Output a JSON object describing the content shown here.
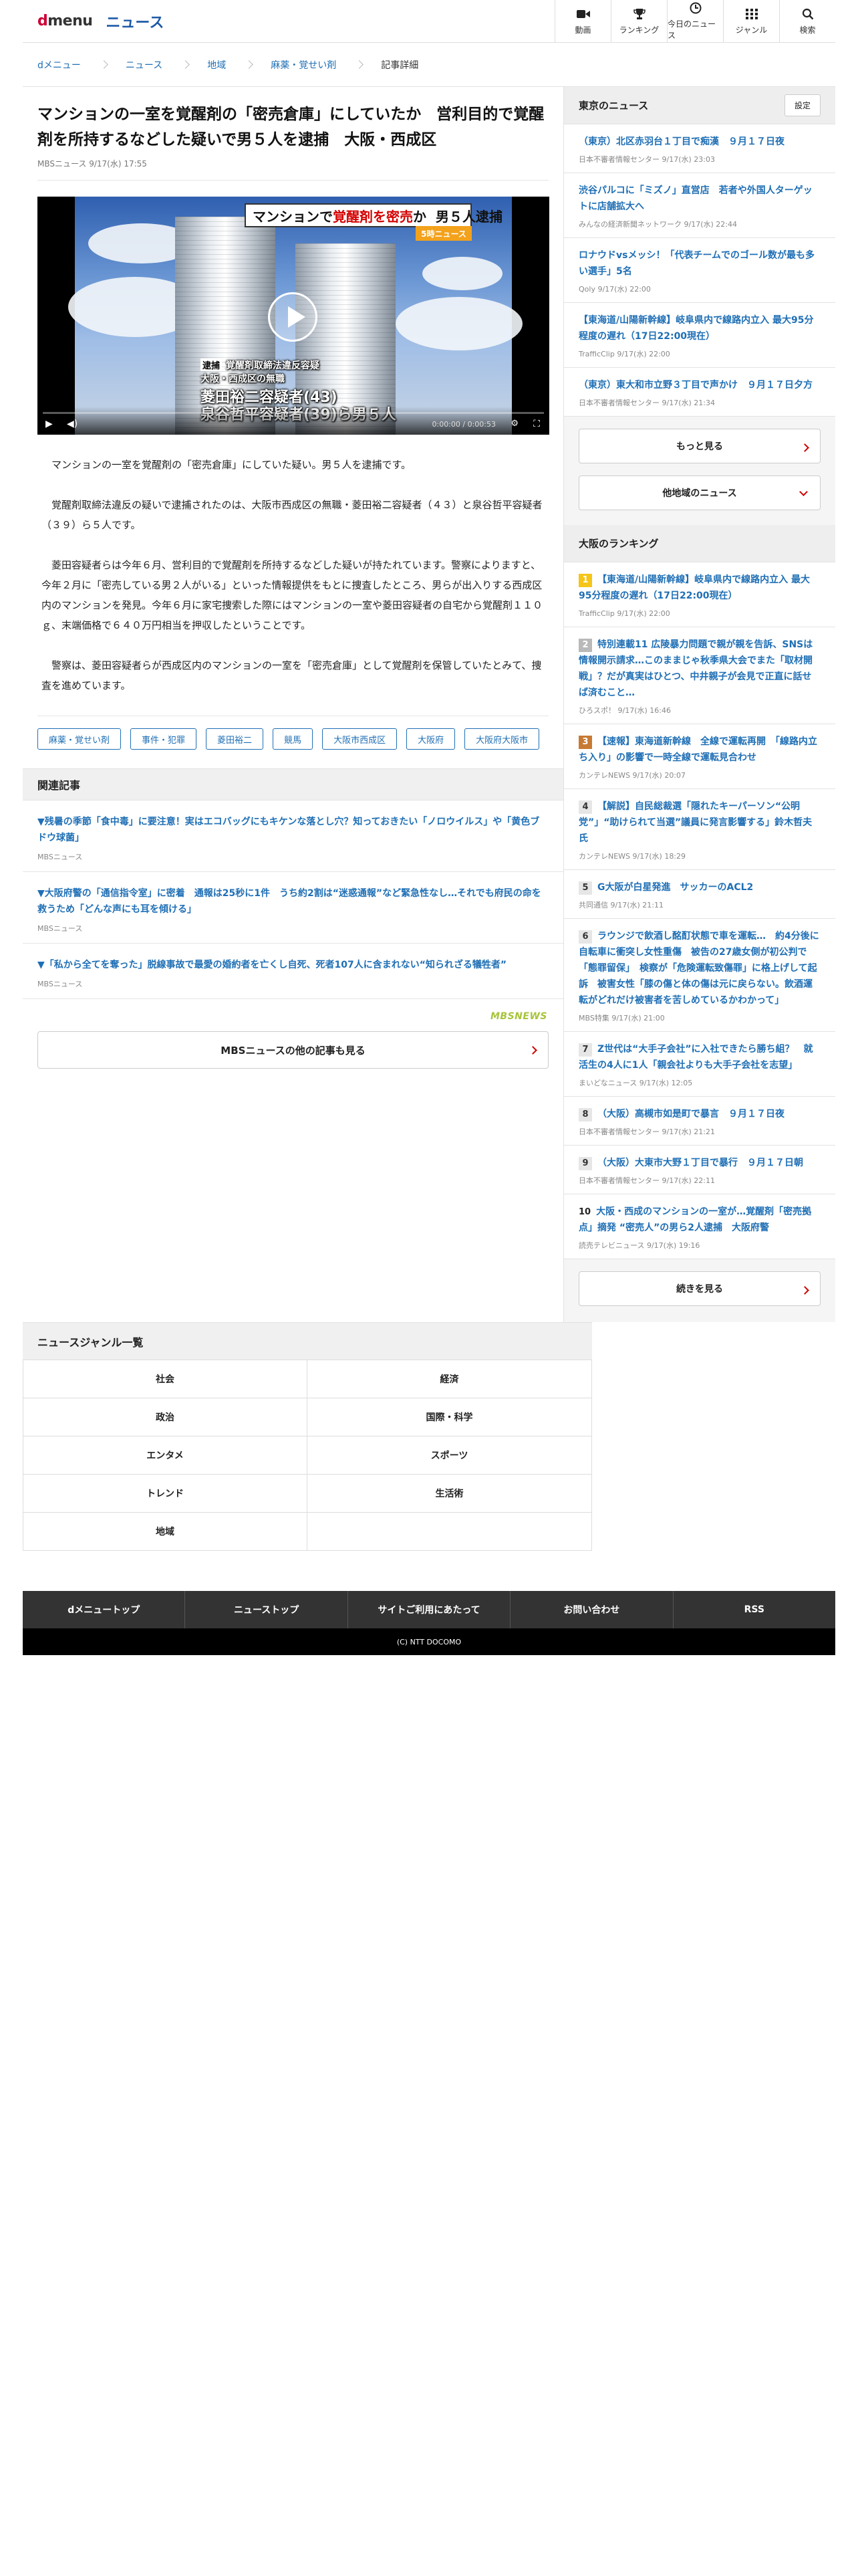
{
  "header": {
    "logo_d": "d",
    "logo_menu": "menu",
    "logo_news": "ニュース",
    "nav": [
      {
        "label": "動画",
        "icon": "video-camera-icon"
      },
      {
        "label": "ランキング",
        "icon": "trophy-icon"
      },
      {
        "label": "今日のニュース",
        "icon": "clock-icon"
      },
      {
        "label": "ジャンル",
        "icon": "grid-icon"
      },
      {
        "label": "検索",
        "icon": "search-icon"
      }
    ]
  },
  "breadcrumb": [
    "dメニュー",
    "ニュース",
    "地域",
    "麻薬・覚せい剤",
    "記事詳細"
  ],
  "article": {
    "title": "マンションの一室を覚醒剤の「密売倉庫」にしていたか　営利目的で覚醒剤を所持するなどした疑いで男５人を逮捕　大阪・西成区",
    "meta": "MBSニュース 9/17(水) 17:55",
    "video": {
      "banner_prefix": "マンションで",
      "banner_red": "覚醒剤を密売",
      "banner_suffix": "か",
      "banner_tail": "男５人逮捕",
      "badge": "5時ニュース",
      "cap_tag": "逮捕",
      "cap_line1": "覚醒剤取締法違反容疑",
      "cap_line2": "大阪・西成区の無職",
      "cap_line3": "菱田裕二容疑者(43)",
      "cap_line4": "泉谷哲平容疑者(39)ら男５人",
      "time": "0:00:00 / 0:00:53"
    },
    "paragraphs": [
      "マンションの一室を覚醒剤の「密売倉庫」にしていた疑い。男５人を逮捕です。",
      "覚醒剤取締法違反の疑いで逮捕されたのは、大阪市西成区の無職・菱田裕二容疑者（４３）と泉谷哲平容疑者（３９）ら５人です。",
      "菱田容疑者らは今年６月、営利目的で覚醒剤を所持するなどした疑いが持たれています。警察によりますと、今年２月に「密売している男２人がいる」といった情報提供をもとに捜査したところ、男らが出入りする西成区内のマンションを発見。今年６月に家宅捜索した際にはマンションの一室や菱田容疑者の自宅から覚醒剤１１０ｇ、末端価格で６４０万円相当を押収したということです。",
      "警察は、菱田容疑者らが西成区内のマンションの一室を「密売倉庫」として覚醒剤を保管していたとみて、捜査を進めています。"
    ],
    "tags": [
      "麻薬・覚せい剤",
      "事件・犯罪",
      "菱田裕二",
      "競馬",
      "大阪市西成区",
      "大阪府",
      "大阪府大阪市"
    ]
  },
  "related": {
    "heading": "関連記事",
    "items": [
      {
        "title": "▼残暑の季節「食中毒」に要注意！実はエコバッグにもキケンな落とし穴？知っておきたい「ノロウイルス」や「黄色ブドウ球菌」",
        "source": "MBSニュース"
      },
      {
        "title": "▼大阪府警の「通信指令室」に密着　通報は25秒に1件　うち約2割は“迷惑通報”など緊急性なし…それでも府民の命を救うため「どんな声にも耳を傾ける」",
        "source": "MBSニュース"
      },
      {
        "title": "▼「私から全てを奪った」脱線事故で最愛の婚約者を亡くし自死、死者107人に含まれない“知られざる犠牲者”",
        "source": "MBSニュース"
      }
    ],
    "provider_logo": "MBSNEWS",
    "more_label": "MBSニュースの他の記事も見る"
  },
  "sidebar": {
    "local_heading": "東京のニュース",
    "settings_label": "設定",
    "local_items": [
      {
        "title": "（東京）北区赤羽台１丁目で痴漢　９月１７日夜",
        "source": "日本不審者情報センター 9/17(水) 23:03"
      },
      {
        "title": "渋谷パルコに「ミズノ」直営店　若者や外国人ターゲットに店舗拡大へ",
        "source": "みんなの経済新聞ネットワーク 9/17(水) 22:44"
      },
      {
        "title": "ロナウドvsメッシ！「代表チームでのゴール数が最も多い選手」5名",
        "source": "Qoly 9/17(水) 22:00"
      },
      {
        "title": "【東海道/山陽新幹線】岐阜県内で線路内立入 最大95分程度の遅れ（17日22:00現在）",
        "source": "TrafficClip 9/17(水) 22:00"
      },
      {
        "title": "（東京）東大和市立野３丁目で声かけ　９月１７日夕方",
        "source": "日本不審者情報センター 9/17(水) 21:34"
      }
    ],
    "more_label": "もっと見る",
    "other_region_label": "他地域のニュース",
    "ranking_heading": "大阪のランキング",
    "ranking": [
      {
        "rank": "1",
        "style": "gold",
        "title": "【東海道/山陽新幹線】岐阜県内で線路内立入 最大95分程度の遅れ（17日22:00現在）",
        "source": "TrafficClip 9/17(水) 22:00"
      },
      {
        "rank": "2",
        "style": "silver",
        "title": "特別連載11 広陵暴力問題で親が親を告訴、SNSは情報開示請求…このままじゃ秋季県大会でまた「取材開戦」？だが真実はひとつ、中井親子が会見で正直に話せば済むこと…",
        "source": "ひろスポ！ 9/17(水) 16:46"
      },
      {
        "rank": "3",
        "style": "bronze",
        "title": "【速報】東海道新幹線　全線で運転再開　「線路内立ち入り」の影響で一時全線で運転見合わせ",
        "source": "カンテレNEWS 9/17(水) 20:07"
      },
      {
        "rank": "4",
        "style": "plain",
        "title": "【解説】自民総裁選「隠れたキーパーソン“公明党”」“助けられて当選”議員に発言影響する」鈴木哲夫氏",
        "source": "カンテレNEWS 9/17(水) 18:29"
      },
      {
        "rank": "5",
        "style": "plain",
        "title": "G大阪が白星発進　サッカーのACL2",
        "source": "共同通信 9/17(水) 21:11"
      },
      {
        "rank": "6",
        "style": "plain",
        "title": "ラウンジで飲酒し酩酊状態で車を運転…　約4分後に自転車に衝突し女性重傷　被告の27歳女側が初公判で「態罪留保」　検察が「危険運転致傷罪」に格上げして起訴　被害女性「膝の傷と体の傷は元に戻らない。飲酒運転がどれだけ被害者を苦しめているかわかって」",
        "source": "MBS特集 9/17(水) 21:00"
      },
      {
        "rank": "7",
        "style": "plain",
        "title": "Z世代は“大手子会社”に入社できたら勝ち組？　就活生の4人に1人「親会社よりも大手子会社を志望」",
        "source": "まいどなニュース 9/17(水) 12:05"
      },
      {
        "rank": "8",
        "style": "plain",
        "title": "（大阪）高槻市如是町で暴言　９月１７日夜",
        "source": "日本不審者情報センター 9/17(水) 21:21"
      },
      {
        "rank": "9",
        "style": "plain",
        "title": "（大阪）大東市大野１丁目で暴行　９月１７日朝",
        "source": "日本不審者情報センター 9/17(水) 22:11"
      },
      {
        "rank": "10",
        "style": "none",
        "title": "大阪・西成のマンションの一室が…覚醒剤「密売拠点」摘発 “密売人”の男ら2人逮捕　大阪府警",
        "source": "読売テレビニュース 9/17(水) 19:16"
      }
    ],
    "continue_label": "続きを見る"
  },
  "genres": {
    "heading": "ニュースジャンル一覧",
    "items": [
      "社会",
      "経済",
      "政治",
      "国際・科学",
      "エンタメ",
      "スポーツ",
      "トレンド",
      "生活術",
      "地域",
      ""
    ]
  },
  "footer": {
    "links": [
      "dメニュートップ",
      "ニューストップ",
      "サイトご利用にあたって",
      "お問い合わせ",
      "RSS"
    ],
    "copyright": "(C) NTT DOCOMO"
  },
  "colors": {
    "brand_red": "#cc0033",
    "link_blue": "#1f6fb5",
    "accent_arrow": "#cc0000"
  }
}
